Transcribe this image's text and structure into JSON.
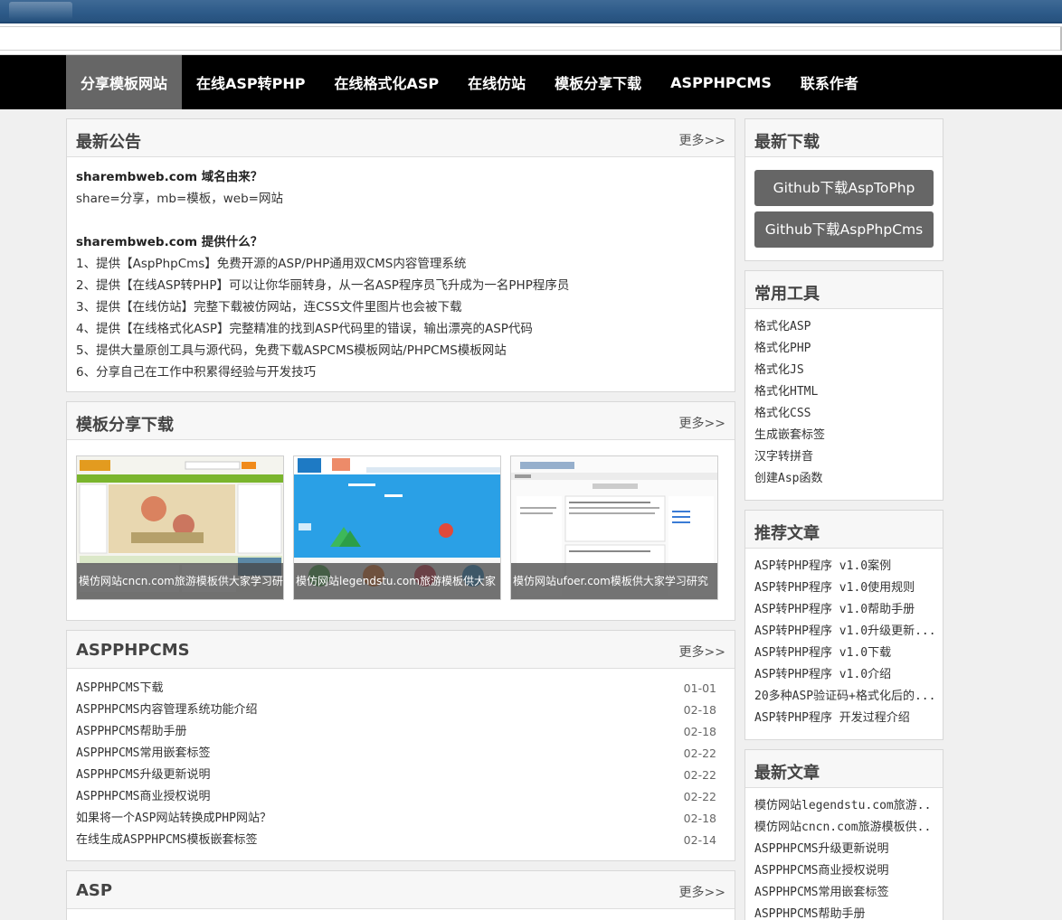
{
  "nav": {
    "items": [
      "分享模板网站",
      "在线ASP转PHP",
      "在线格式化ASP",
      "在线仿站",
      "模板分享下载",
      "ASPPHPCMS",
      "联系作者"
    ]
  },
  "notice": {
    "title": "最新公告",
    "more": "更多>>",
    "q1": "sharembweb.com 域名由来？",
    "a1": "share=分享，mb=模板，web=网站",
    "q2": "sharembweb.com 提供什么？",
    "items": [
      "1、提供【AspPhpCms】免费开源的ASP/PHP通用双CMS内容管理系统",
      "2、提供【在线ASP转PHP】可以让你华丽转身，从一名ASP程序员飞升成为一名PHP程序员",
      "3、提供【在线仿站】完整下载被仿网站，连CSS文件里图片也会被下载",
      "4、提供【在线格式化ASP】完整精准的找到ASP代码里的错误，输出漂亮的ASP代码",
      "5、提供大量原创工具与源代码，免费下载ASPCMS模板网站/PHPCMS模板网站",
      "6、分享自己在工作中积累得经验与开发技巧"
    ]
  },
  "templates": {
    "title": "模板分享下载",
    "more": "更多>>",
    "items": [
      "模仿网站cncn.com旅游模板供大家学习研",
      "模仿网站legendstu.com旅游模板供大家",
      "模仿网站ufoer.com模板供大家学习研究"
    ]
  },
  "aspphpcms": {
    "title": "ASPPHPCMS",
    "more": "更多>>",
    "rows": [
      {
        "t": "ASPPHPCMS下载",
        "d": "01-01"
      },
      {
        "t": "ASPPHPCMS内容管理系统功能介绍",
        "d": "02-18"
      },
      {
        "t": "ASPPHPCMS帮助手册",
        "d": "02-18"
      },
      {
        "t": "ASPPHPCMS常用嵌套标签",
        "d": "02-22"
      },
      {
        "t": "ASPPHPCMS升级更新说明",
        "d": "02-22"
      },
      {
        "t": "ASPPHPCMS商业授权说明",
        "d": "02-22"
      },
      {
        "t": "如果将一个ASP网站转换成PHP网站？",
        "d": "02-18"
      },
      {
        "t": "在线生成ASPPHPCMS模板嵌套标签",
        "d": "02-14"
      }
    ]
  },
  "asp": {
    "title": "ASP",
    "more": "更多>>"
  },
  "downloads": {
    "title": "最新下载",
    "buttons": [
      "Github下载AspToPhp",
      "Github下载AspPhpCms"
    ]
  },
  "tools": {
    "title": "常用工具",
    "items": [
      "格式化ASP",
      "格式化PHP",
      "格式化JS",
      "格式化HTML",
      "格式化CSS",
      "生成嵌套标签",
      "汉字转拼音",
      "创建Asp函数"
    ]
  },
  "recommend": {
    "title": "推荐文章",
    "items": [
      "ASP转PHP程序 v1.0案例",
      "ASP转PHP程序 v1.0使用规则",
      "ASP转PHP程序 v1.0帮助手册",
      "ASP转PHP程序 v1.0升级更新...",
      "ASP转PHP程序 v1.0下载",
      "ASP转PHP程序 v1.0介绍",
      "20多种ASP验证码+格式化后的...",
      "ASP转PHP程序 开发过程介绍"
    ]
  },
  "latest": {
    "title": "最新文章",
    "items": [
      "模仿网站legendstu.com旅游...",
      "模仿网站cncn.com旅游模板供...",
      "ASPPHPCMS升级更新说明",
      "ASPPHPCMS商业授权说明",
      "ASPPHPCMS常用嵌套标签",
      "ASPPHPCMS帮助手册"
    ]
  },
  "colors": {
    "nav_bg": "#000000",
    "nav_active": "#666666",
    "button_bg": "#666666"
  }
}
